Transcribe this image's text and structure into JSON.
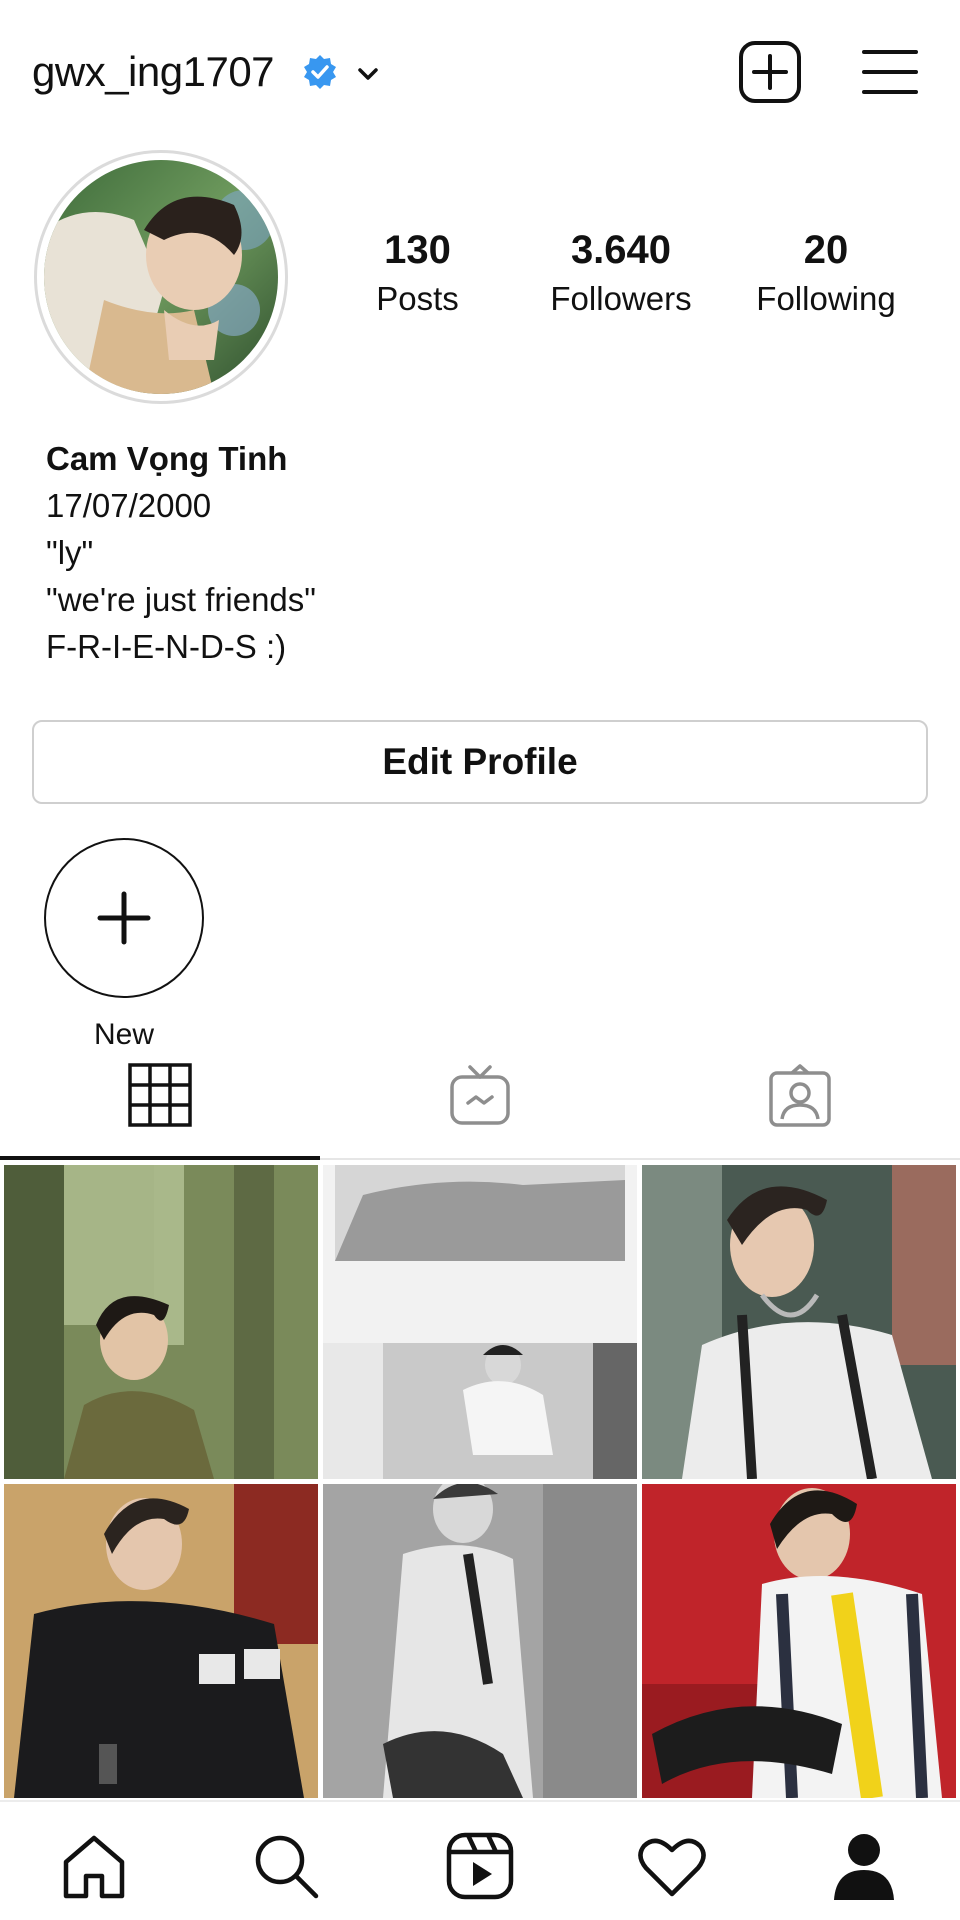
{
  "header": {
    "username": "gwx_ing1707",
    "verified_icon": "verified-badge-icon",
    "dropdown_icon": "chevron-down-icon",
    "new_post_icon": "plus-square-icon",
    "menu_icon": "hamburger-menu-icon",
    "verified_color": "#3897f0"
  },
  "stats": {
    "posts": {
      "value": "130",
      "label": "Posts"
    },
    "followers": {
      "value": "3.640",
      "label": "Followers"
    },
    "following": {
      "value": "20",
      "label": "Following"
    }
  },
  "bio": {
    "name": "Cam Vọng Tinh",
    "lines": [
      "17/07/2000",
      "\"ly\"",
      "\"we're just friends\"",
      "F-R-I-E-N-D-S :)"
    ]
  },
  "edit_profile_label": "Edit Profile",
  "highlights": {
    "new_label": "New",
    "new_icon": "plus-icon"
  },
  "tabs": [
    {
      "icon": "grid-icon",
      "active": true
    },
    {
      "icon": "igtv-icon",
      "active": false
    },
    {
      "icon": "tagged-icon",
      "active": false
    }
  ],
  "bottom_nav": [
    {
      "icon": "home-icon"
    },
    {
      "icon": "search-icon"
    },
    {
      "icon": "reels-icon"
    },
    {
      "icon": "heart-icon"
    },
    {
      "icon": "profile-icon"
    }
  ]
}
